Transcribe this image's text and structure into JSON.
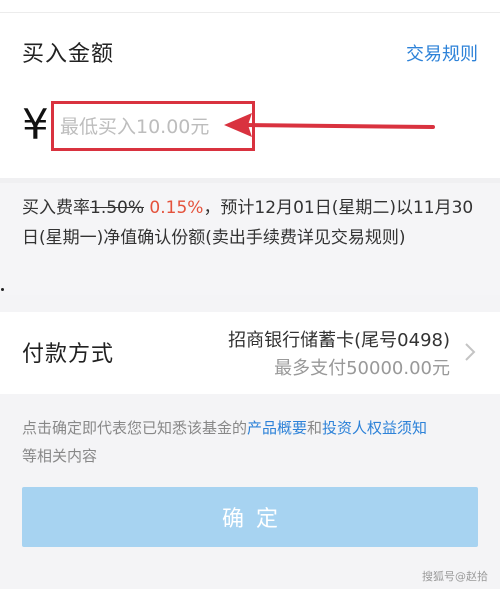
{
  "purchase": {
    "title": "买入金额",
    "rules_link": "交易规则",
    "currency_symbol": "¥",
    "amount_placeholder": "最低买入10.00元"
  },
  "fee": {
    "label": "买入费率",
    "old_rate": "1.50%",
    "new_rate": "0.15%",
    "description": "，预计12月01日(星期二)以11月30日(星期一)净值确认份额(卖出手续费详见交易规则)"
  },
  "payment": {
    "title": "付款方式",
    "bank": "招商银行储蓄卡(尾号0498)",
    "limit": "最多支付50000.00元"
  },
  "notice": {
    "prefix": "点击确定即代表您已知悉该基金的",
    "link1": "产品概要",
    "and": "和",
    "link2": "投资人权益须知",
    "suffix": "等相关内容"
  },
  "confirm_label": "确定",
  "watermark": "搜狐号@赵拾",
  "colors": {
    "accent_blue": "#2d82d8",
    "highlight_red": "#d9323f",
    "rate_orange": "#e4523c",
    "button_disabled": "#a7d3f1"
  }
}
